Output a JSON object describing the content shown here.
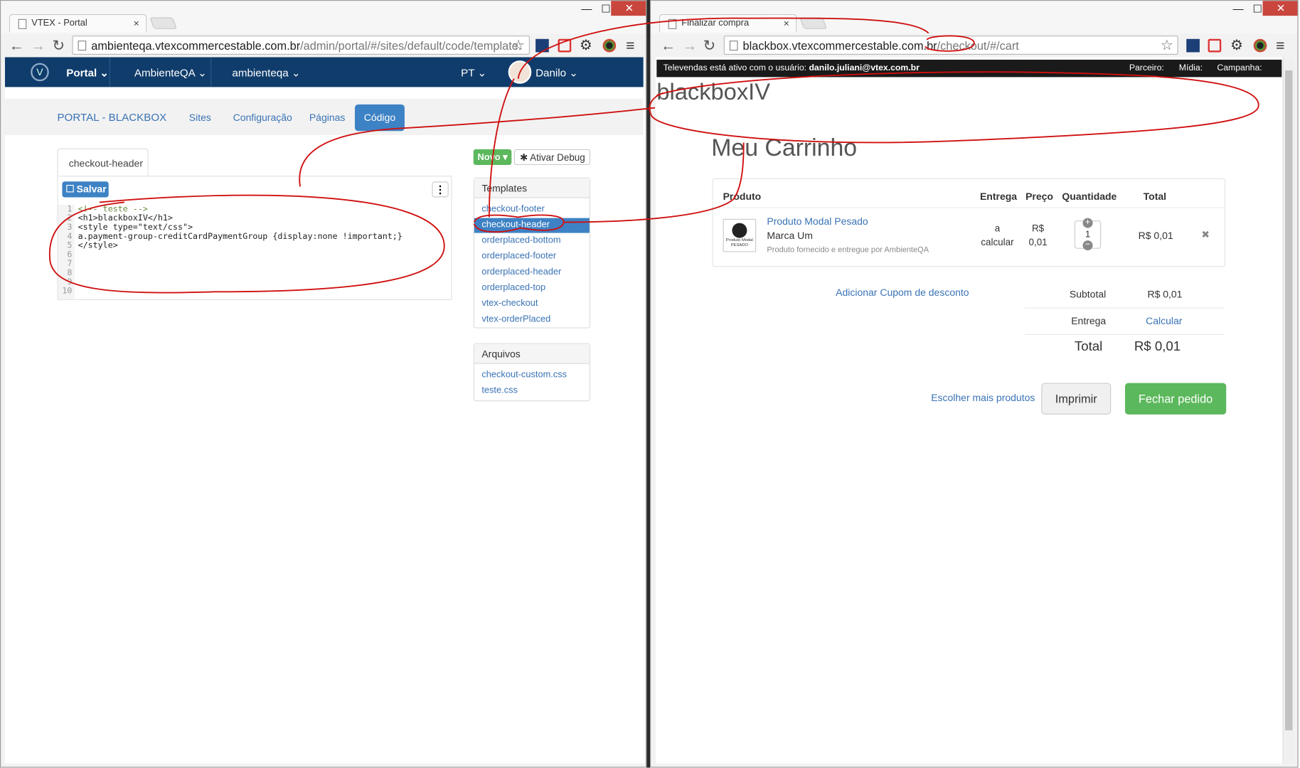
{
  "left_window": {
    "tab_title": "VTEX - Portal",
    "tab_close": "×",
    "url_main": "ambienteqa.vtexcommercestable.com.br",
    "url_rest": "/admin/portal/#/sites/default/code/template:",
    "window_controls": {
      "minimize": "—",
      "maximize": "☐",
      "close": "✕"
    },
    "topbar": {
      "portal": "Portal",
      "store": "AmbienteQA",
      "account": "ambienteqa",
      "language": "PT",
      "user": "Danilo"
    },
    "subnav": {
      "brand": "PORTAL - BLACKBOX",
      "sites": "Sites",
      "config": "Configuração",
      "pages": "Páginas",
      "code": "Código"
    },
    "editor": {
      "file_tab": "checkout-header",
      "save": "Salvar",
      "more": "⋮",
      "line_numbers": [
        "1",
        "2",
        "3",
        "4",
        "5",
        "6",
        "7",
        "8",
        "9",
        "10"
      ],
      "lines": [
        "<!-- teste -->",
        "<h1>blackboxIV</h1>",
        "<style type=\"text/css\">",
        "a.payment-group-creditCardPaymentGroup {display:none !important;}",
        "</style>"
      ]
    },
    "actions": {
      "new": "Novo",
      "debug": "Ativar Debug"
    },
    "templates": {
      "title": "Templates",
      "items": [
        "checkout-footer",
        "checkout-header",
        "orderplaced-bottom",
        "orderplaced-footer",
        "orderplaced-header",
        "orderplaced-top",
        "vtex-checkout",
        "vtex-orderPlaced"
      ],
      "selected_index": 1
    },
    "files": {
      "title": "Arquivos",
      "items": [
        "checkout-custom.css",
        "teste.css"
      ]
    }
  },
  "right_window": {
    "tab_title": "Finalizar compra",
    "tab_close": "×",
    "url_main": "blackbox.vtexcommercestable.com.br",
    "url_rest": "/checkout/#/cart",
    "window_controls": {
      "minimize": "—",
      "maximize": "☐",
      "close": "✕"
    },
    "televendas_prefix": "Televendas está ativo com o usuário: ",
    "televendas_user": "danilo.juliani@vtex.com.br",
    "televendas_fields": [
      "Parceiro:",
      "Mídia:",
      "Campanha:"
    ],
    "store_title": "blackboxIV",
    "page_title": "Meu Carrinho",
    "table_headers": {
      "product": "Produto",
      "delivery": "Entrega",
      "price": "Preço",
      "quantity": "Quantidade",
      "total": "Total"
    },
    "item": {
      "thumb_caption": "Produto Modal PESADO",
      "name": "Produto Modal Pesado",
      "brand": "Marca Um",
      "seller_note": "Produto fornecido e entregue por AmbienteQA",
      "delivery_line1": "a",
      "delivery_line2": "calcular",
      "price_line1": "R$",
      "price_line2": "0,01",
      "quantity": "1",
      "total": "R$ 0,01",
      "remove": "✖"
    },
    "coupon_link": "Adicionar Cupom de desconto",
    "summary": {
      "subtotal_label": "Subtotal",
      "subtotal_value": "R$ 0,01",
      "shipping_label": "Entrega",
      "shipping_value": "Calcular",
      "total_label": "Total",
      "total_value": "R$ 0,01"
    },
    "buttons": {
      "more_products": "Escolher mais produtos",
      "print": "Imprimir",
      "place_order": "Fechar pedido"
    }
  },
  "colors": {
    "vtex_navy": "#0f3c6b",
    "link_blue": "#3a73b5",
    "code_button": "#3d82c4",
    "green_button": "#5cb85c",
    "annotation_red": "#d01010"
  }
}
